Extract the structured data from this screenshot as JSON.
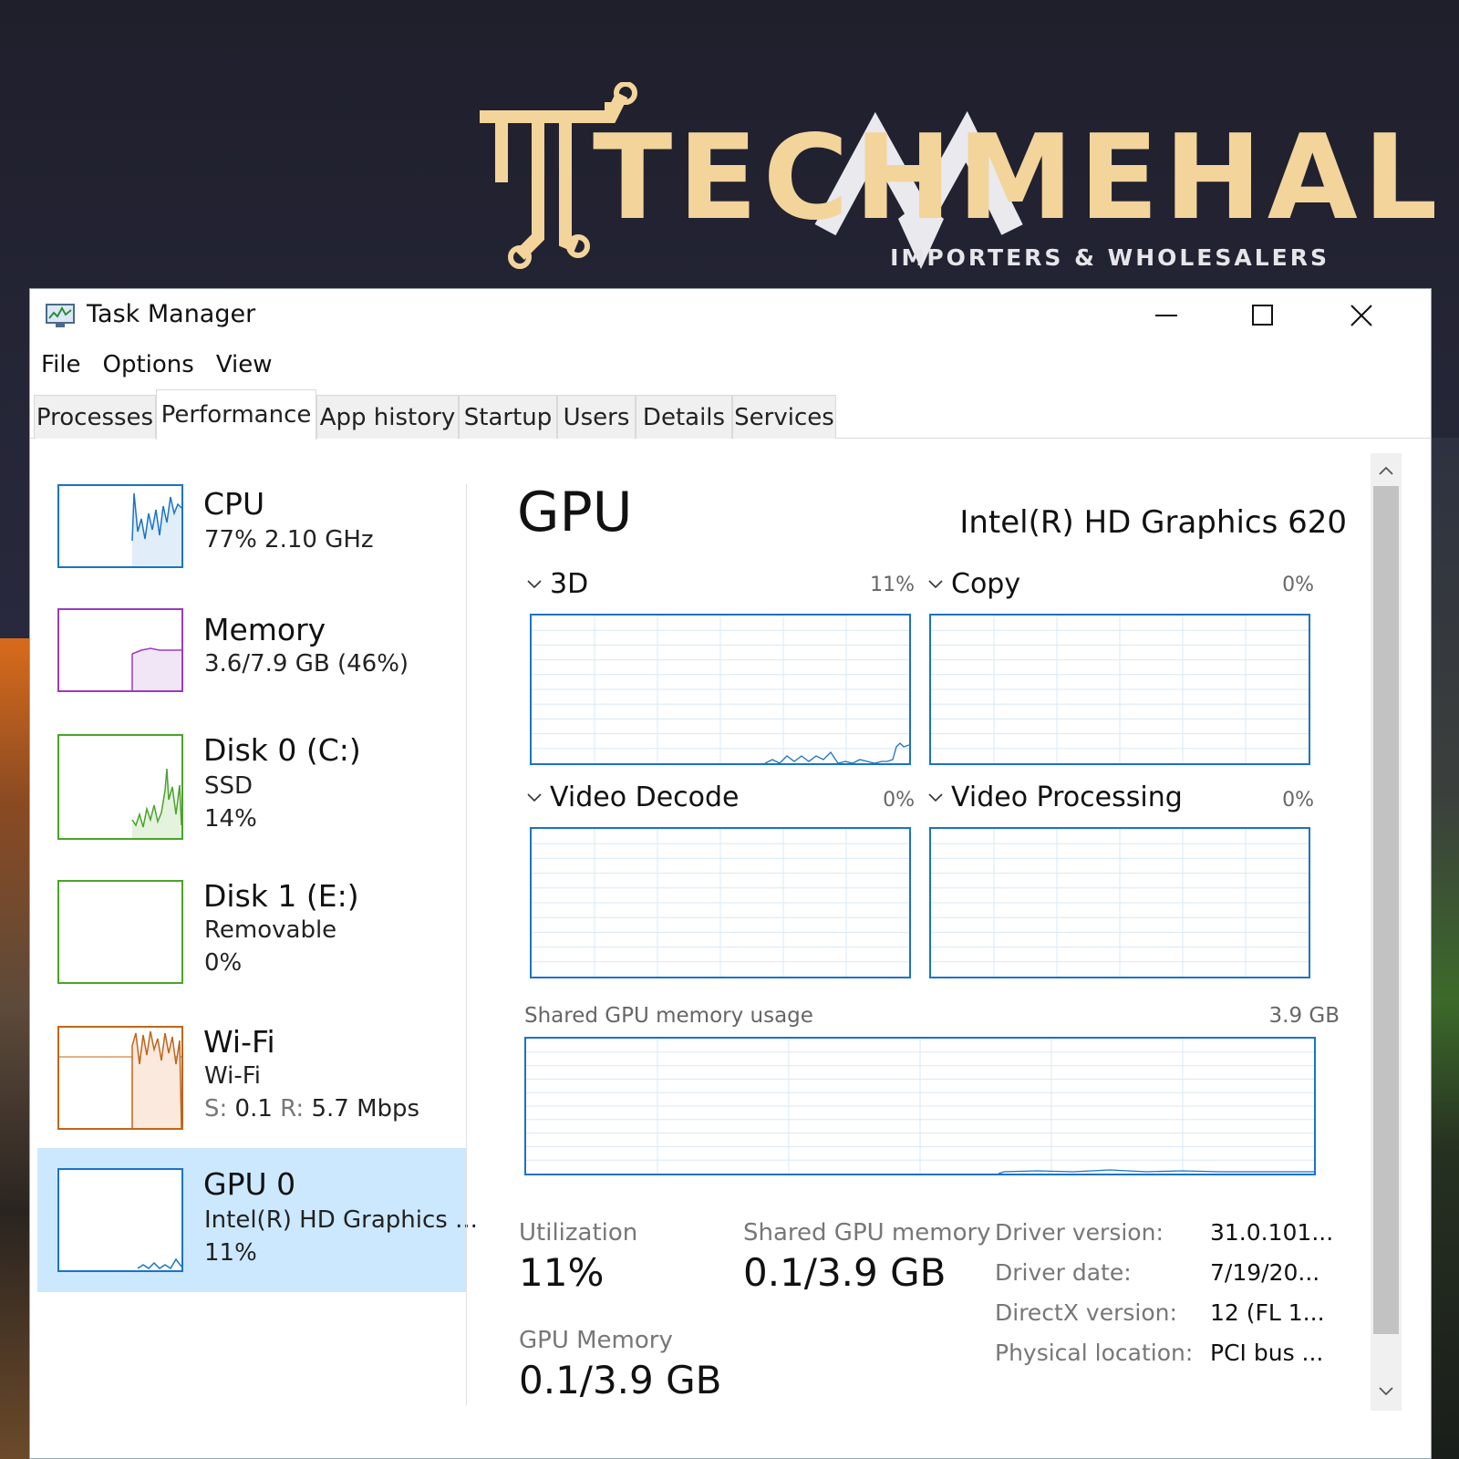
{
  "logo": {
    "word": "TECHMEHAL",
    "tagline": "IMPORTERS & WHOLESALERS"
  },
  "window": {
    "title": "Task Manager",
    "icon": "task-manager-icon"
  },
  "menu": [
    "File",
    "Options",
    "View"
  ],
  "tabs": [
    {
      "label": "Processes"
    },
    {
      "label": "Performance"
    },
    {
      "label": "App history"
    },
    {
      "label": "Startup"
    },
    {
      "label": "Users"
    },
    {
      "label": "Details"
    },
    {
      "label": "Services"
    }
  ],
  "active_tab": "Performance",
  "resources": [
    {
      "title": "CPU",
      "line1": "77%  2.10 GHz",
      "color": "#1a73c7"
    },
    {
      "title": "Memory",
      "line1": "3.6/7.9 GB (46%)",
      "color": "#9a3bbf"
    },
    {
      "title": "Disk 0 (C:)",
      "line1": "SSD",
      "line2": "14%",
      "color": "#4aa32a"
    },
    {
      "title": "Disk 1 (E:)",
      "line1": "Removable",
      "line2": "0%",
      "color": "#4aa32a"
    },
    {
      "title": "Wi-Fi",
      "line1": "Wi-Fi",
      "line2_s": "S:",
      "line2_sv": " 0.1 ",
      "line2_r": "R:",
      "line2_rv": " 5.7 Mbps",
      "color": "#c0651a"
    },
    {
      "title": "GPU 0",
      "line1": "Intel(R) HD Graphics ...",
      "line2": "11%",
      "color": "#1a73c7"
    }
  ],
  "gpu": {
    "heading": "GPU",
    "model": "Intel(R) HD Graphics 620",
    "engines": [
      {
        "name": "3D",
        "percent": "11%"
      },
      {
        "name": "Copy",
        "percent": "0%"
      },
      {
        "name": "Video Decode",
        "percent": "0%"
      },
      {
        "name": "Video Processing",
        "percent": "0%"
      }
    ],
    "shared_label": "Shared GPU memory usage",
    "shared_max": "3.9 GB",
    "stats": {
      "utilization_label": "Utilization",
      "utilization_value": "11%",
      "shared_mem_label": "Shared GPU memory",
      "shared_mem_value": "0.1/3.9 GB",
      "gpu_mem_label": "GPU Memory",
      "gpu_mem_value": "0.1/3.9 GB"
    },
    "details": [
      {
        "key": "Driver version:",
        "value": "31.0.101..."
      },
      {
        "key": "Driver date:",
        "value": "7/19/20..."
      },
      {
        "key": "DirectX version:",
        "value": "12 (FL 1..."
      },
      {
        "key": "Physical location:",
        "value": "PCI bus ..."
      }
    ]
  }
}
